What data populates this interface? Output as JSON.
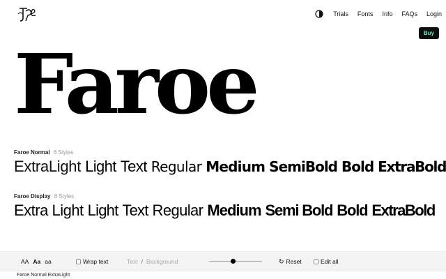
{
  "nav": {
    "items": [
      "Trials",
      "Fonts",
      "Info",
      "FAQs",
      "Login"
    ],
    "buy": "Buy"
  },
  "hero": {
    "title": "Faroe"
  },
  "families": [
    {
      "name": "Faroe Normal",
      "count": "8 Styles",
      "styles": [
        "ExtraLight",
        "Light",
        "Text",
        "Regular",
        "Medium",
        "SemiBold",
        "Bold",
        "ExtraBold"
      ]
    },
    {
      "name": "Faroe Display",
      "count": "8 Styles",
      "styles": [
        "Extra Light",
        "Light",
        "Text",
        "Regular",
        "Medium",
        "Semi Bold",
        "Bold",
        "ExtraBold"
      ]
    }
  ],
  "toolbar": {
    "sizes": [
      "AA",
      "Aa",
      "aa"
    ],
    "wrap_text": "Wrap text",
    "text_label": "Text",
    "separator": "/",
    "background_label": "Background",
    "reset": "Reset",
    "edit_all": "Edit all",
    "slider_level": 0.45
  },
  "status": {
    "font_name": "Faroe Normal ExtraLight"
  },
  "colors": {
    "buy_bg": "#0d0d0d",
    "buy_text": "#6ee7b7"
  }
}
